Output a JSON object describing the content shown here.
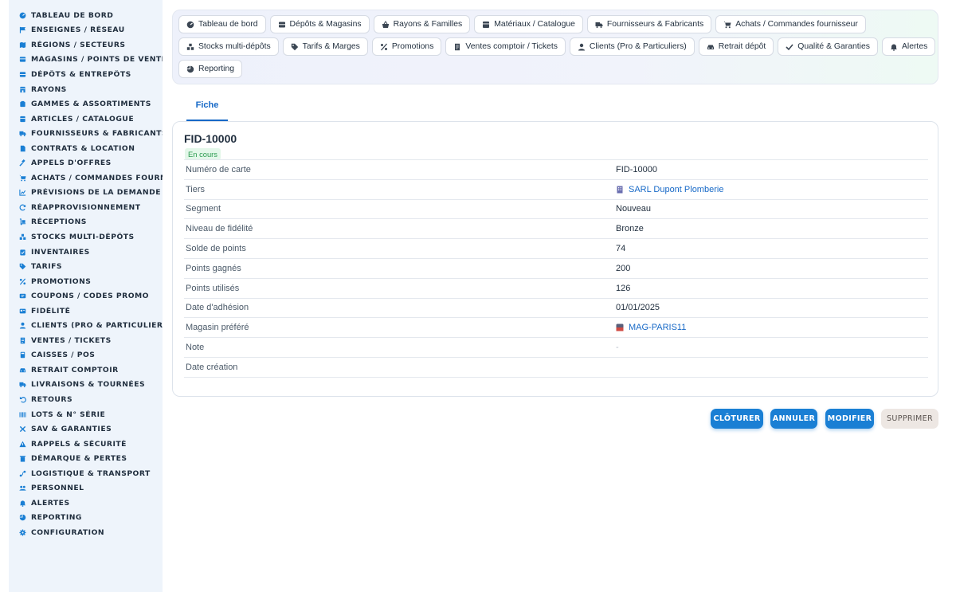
{
  "colors": {
    "accent": "#1a7fd4",
    "link": "#1769c7",
    "sidebar_bg": "#eef4fb",
    "badge_bg": "#e3f7e9",
    "badge_text": "#2b9b50"
  },
  "sidebar": {
    "items": [
      {
        "label": "TABLEAU DE BORD",
        "icon": "dashboard-icon"
      },
      {
        "label": "ENSEIGNES / RÉSEAU",
        "icon": "flag-icon"
      },
      {
        "label": "RÉGIONS / SECTEURS",
        "icon": "map-icon"
      },
      {
        "label": "MAGASINS / POINTS DE VENTE",
        "icon": "store-icon"
      },
      {
        "label": "DÉPÔTS & ENTREPÔTS",
        "icon": "warehouse-icon"
      },
      {
        "label": "RAYONS",
        "icon": "shelf-icon"
      },
      {
        "label": "GAMMES & ASSORTIMENTS",
        "icon": "layers-icon"
      },
      {
        "label": "ARTICLES / CATALOGUE",
        "icon": "box-icon"
      },
      {
        "label": "FOURNISSEURS & FABRICANTS",
        "icon": "truck-icon"
      },
      {
        "label": "CONTRATS & LOCATION",
        "icon": "document-icon"
      },
      {
        "label": "APPELS D'OFFRES",
        "icon": "gavel-icon"
      },
      {
        "label": "ACHATS / COMMANDES FOURNISSEUR",
        "icon": "cart-icon"
      },
      {
        "label": "PRÉVISIONS DE LA DEMANDE",
        "icon": "chart-icon"
      },
      {
        "label": "RÉAPPROVISIONNEMENT",
        "icon": "refresh-icon"
      },
      {
        "label": "RÉCEPTIONS",
        "icon": "dolly-icon"
      },
      {
        "label": "STOCKS MULTI-DÉPÔTS",
        "icon": "stock-icon"
      },
      {
        "label": "INVENTAIRES",
        "icon": "clipboard-icon"
      },
      {
        "label": "TARIFS",
        "icon": "tag-icon"
      },
      {
        "label": "PROMOTIONS",
        "icon": "percent-icon"
      },
      {
        "label": "COUPONS / CODES PROMO",
        "icon": "ticket-icon"
      },
      {
        "label": "FIDÉLITÉ",
        "icon": "card-icon"
      },
      {
        "label": "CLIENTS (PRO & PARTICULIERS)",
        "icon": "user-icon"
      },
      {
        "label": "VENTES / TICKETS",
        "icon": "receipt-icon"
      },
      {
        "label": "CAISSES / POS",
        "icon": "register-icon"
      },
      {
        "label": "RETRAIT COMPTOIR",
        "icon": "car-icon"
      },
      {
        "label": "LIVRAISONS & TOURNÉES",
        "icon": "delivery-icon"
      },
      {
        "label": "RETOURS",
        "icon": "undo-icon"
      },
      {
        "label": "LOTS & N° SÉRIE",
        "icon": "barcode-icon"
      },
      {
        "label": "SAV & GARANTIES",
        "icon": "tools-icon"
      },
      {
        "label": "RAPPELS & SÉCURITÉ",
        "icon": "warning-icon"
      },
      {
        "label": "DÉMARQUE & PERTES",
        "icon": "trash-icon"
      },
      {
        "label": "LOGISTIQUE & TRANSPORT",
        "icon": "route-icon"
      },
      {
        "label": "PERSONNEL",
        "icon": "users-icon"
      },
      {
        "label": "ALERTES",
        "icon": "bell-icon"
      },
      {
        "label": "REPORTING",
        "icon": "pie-icon"
      },
      {
        "label": "CONFIGURATION",
        "icon": "gear-icon"
      }
    ]
  },
  "topnav": {
    "row1": [
      {
        "label": "Tableau de bord",
        "icon": "dashboard-icon"
      },
      {
        "label": "Dépôts & Magasins",
        "icon": "warehouse-icon"
      },
      {
        "label": "Rayons & Familles",
        "icon": "basket-icon"
      },
      {
        "label": "Matériaux / Catalogue",
        "icon": "box-icon"
      },
      {
        "label": "Fournisseurs & Fabricants",
        "icon": "truck-icon"
      },
      {
        "label": "Achats / Commandes fournisseur",
        "icon": "cart-icon"
      }
    ],
    "row2": [
      {
        "label": "Stocks multi-dépôts",
        "icon": "stock-icon"
      },
      {
        "label": "Tarifs & Marges",
        "icon": "tag-icon"
      },
      {
        "label": "Promotions",
        "icon": "percent-icon"
      },
      {
        "label": "Ventes comptoir / Tickets",
        "icon": "receipt-icon"
      },
      {
        "label": "Clients (Pro & Particuliers)",
        "icon": "user-icon"
      },
      {
        "label": "Retrait dépôt",
        "icon": "car-icon"
      },
      {
        "label": "Qualité & Garanties",
        "icon": "check-icon"
      },
      {
        "label": "Alertes",
        "icon": "bell-icon"
      }
    ],
    "row3": [
      {
        "label": "Reporting",
        "icon": "pie-icon"
      }
    ]
  },
  "tabs": {
    "fiche": "Fiche"
  },
  "record": {
    "title": "FID-10000",
    "status": "En cours",
    "fields": [
      {
        "label": "Numéro de carte",
        "value": "FID-10000"
      },
      {
        "label": "Tiers",
        "value": "SARL Dupont Plomberie",
        "icon": "building-icon"
      },
      {
        "label": "Segment",
        "value": "Nouveau"
      },
      {
        "label": "Niveau de fidélité",
        "value": "Bronze"
      },
      {
        "label": "Solde de points",
        "value": "74"
      },
      {
        "label": "Points gagnés",
        "value": "200"
      },
      {
        "label": "Points utilisés",
        "value": "126"
      },
      {
        "label": "Date d'adhésion",
        "value": "01/01/2025"
      },
      {
        "label": "Magasin préféré",
        "value": "MAG-PARIS11",
        "icon": "store-icon"
      },
      {
        "label": "Note",
        "value": "-"
      },
      {
        "label": "Date création",
        "value": ""
      }
    ]
  },
  "actions": {
    "close": "CLÔTURER",
    "cancel": "ANNULER",
    "edit": "MODIFIER",
    "delete": "SUPPRIMER"
  }
}
